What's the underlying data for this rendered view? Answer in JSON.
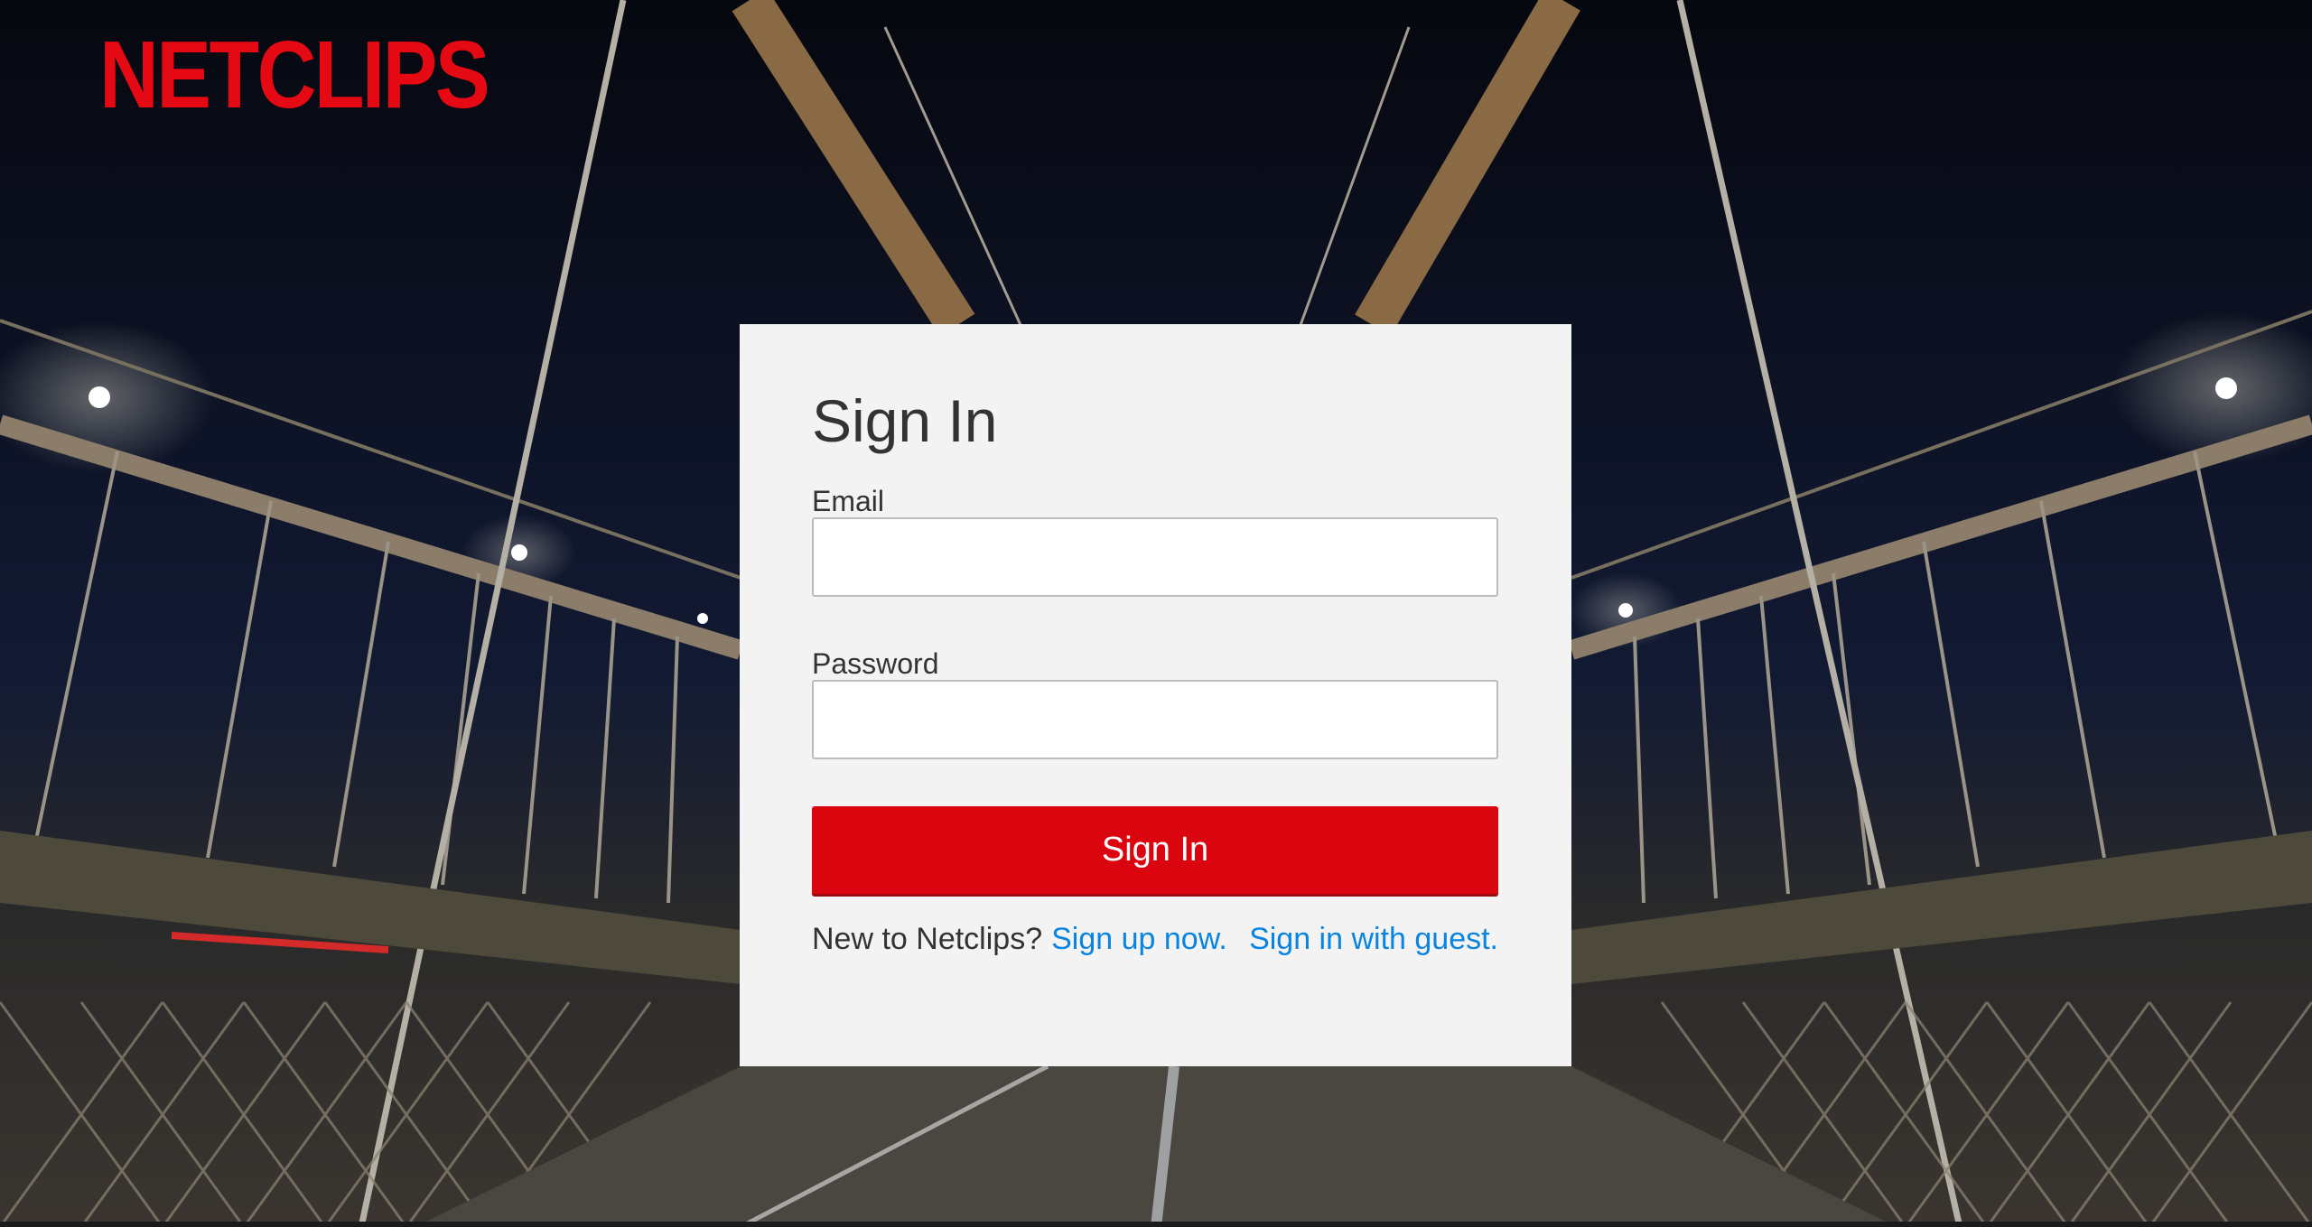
{
  "brand": {
    "logo_text": "NETCLIPS",
    "color": "#e50914"
  },
  "signin_form": {
    "title": "Sign In",
    "email": {
      "label": "Email",
      "value": "",
      "placeholder": ""
    },
    "password": {
      "label": "Password",
      "value": "",
      "placeholder": ""
    },
    "submit_label": "Sign In",
    "submit_color": "#db0510",
    "signup_prompt": "New to Netclips?",
    "signup_link": "Sign up now.",
    "guest_link": "Sign in with guest.",
    "link_color": "#0a84e0"
  }
}
